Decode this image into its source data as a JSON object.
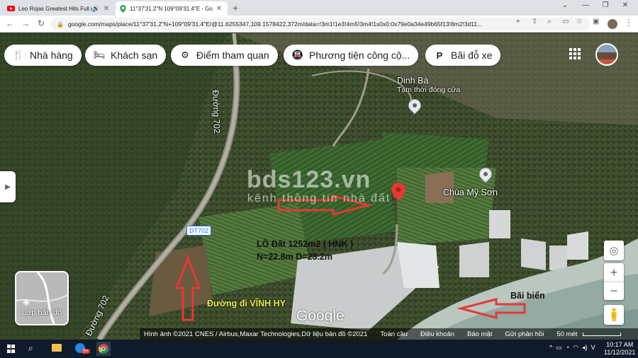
{
  "browser": {
    "tabs": [
      {
        "title": "Leo Rojas Greatest Hits Full A",
        "icon": "youtube-icon",
        "audio": true
      },
      {
        "title": "11°37'31.2\"N 109°09'31.4\"E - Go",
        "icon": "google-maps-icon",
        "active": true
      }
    ],
    "url": "google.com/maps/place/11°37'31.2\"N+109°09'31.4\"E/@11.6255347,109.1578422,372m/data=!3m1!1e3!4m5!3m4!1s0x0:0x79e0a34e49b65f13!8m2!3d11..."
  },
  "maps": {
    "chips": [
      {
        "label": "Nhà hàng",
        "icon": "restaurant-icon"
      },
      {
        "label": "Khách sạn",
        "icon": "hotel-icon"
      },
      {
        "label": "Điểm tham quan",
        "icon": "attraction-icon"
      },
      {
        "label": "Phương tiện công cộ...",
        "icon": "transit-icon"
      },
      {
        "label": "Bãi đỗ xe",
        "icon": "parking-icon"
      }
    ],
    "road_label_702_top": "Đường 702",
    "road_label_702_bottom": "Đường 702",
    "road_badge": "DT702",
    "place_dinh_ba": "Dinh Bà",
    "place_dinh_ba_status": "Tạm thời đóng cửa",
    "place_chua": "Chùa Mỹ Sơn",
    "watermark_title": "bds123.vn",
    "watermark_sub": "kênh thông tin nhà đất",
    "annotation_lot": "LÔ Đất 1252m2 ( HNK )",
    "annotation_dims": "N=22.8m  D=23.2m",
    "annotation_road": "Đường đi VĨNH HY",
    "annotation_beach": "Bãi biển",
    "layers_label": "Lớp bản đồ",
    "google_logo": "Google",
    "footer": {
      "attribution": "Hình ảnh ©2021 CNES / Airbus,Maxar Technologies,Dữ liệu bản đồ ©2021",
      "global": "Toàn cầu",
      "terms": "Điều khoản",
      "privacy": "Bảo mật",
      "feedback": "Gửi phản hồi",
      "scale": "50 mét"
    }
  },
  "taskbar": {
    "time": "10:17 AM",
    "date": "11/12/2021",
    "badge": "5+"
  },
  "colors": {
    "accent_red": "#e53935",
    "map_vegetation": "#3d4f2c",
    "taskbar_bg": "#0f1b2a"
  }
}
